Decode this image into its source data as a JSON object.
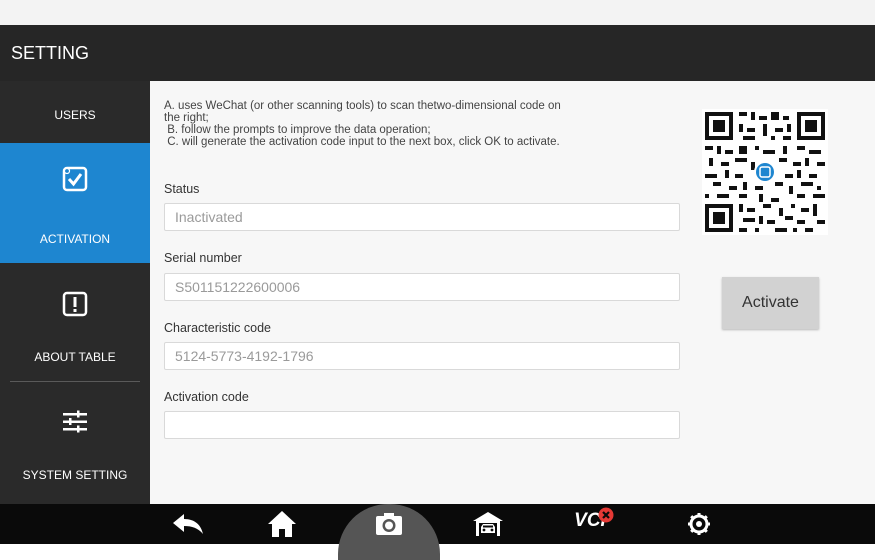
{
  "header": {
    "title": "SETTING"
  },
  "sidebar": {
    "items": [
      {
        "label": "USERS",
        "icon": "users-icon"
      },
      {
        "label": "ACTIVATION",
        "icon": "activation-check-icon",
        "active": true
      },
      {
        "label": "ABOUT TABLE",
        "icon": "info-exclamation-icon"
      },
      {
        "label": "SYSTEM SETTING",
        "icon": "sliders-icon"
      }
    ],
    "active_color": "#1e86d0"
  },
  "activation": {
    "instructions": [
      "A. uses WeChat (or other scanning tools) to scan thetwo-dimensional code on",
      "the right;",
      " B. follow the prompts to improve the data operation;",
      " C. will generate the activation code input to the next box, click OK to activate."
    ],
    "fields": [
      {
        "label": "Status",
        "value": "Inactivated"
      },
      {
        "label": "Serial number",
        "value": "S501151222600006"
      },
      {
        "label": "Characteristic code",
        "value": "5124-5773-4192-1796"
      },
      {
        "label": "Activation code",
        "value": ""
      }
    ],
    "activate_label": "Activate",
    "qr_icon": "qr-code-icon"
  },
  "bottom_nav": {
    "items": [
      "back-icon",
      "home-icon",
      "camera-icon",
      "car-garage-icon",
      "vci-icon",
      "settings-icon"
    ],
    "vci_label": "VCI",
    "vci_status_color": "#e53935"
  }
}
